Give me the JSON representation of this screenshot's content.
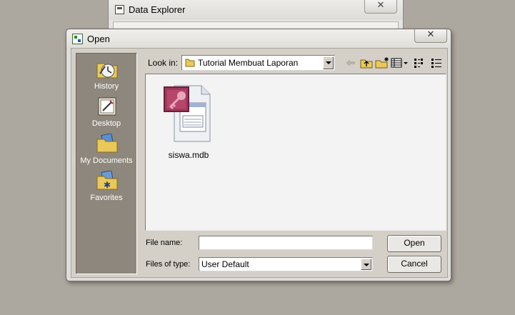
{
  "background_window": {
    "title": "Data Explorer",
    "close_label": "✕"
  },
  "dialog": {
    "title": "Open",
    "close_label": "✕"
  },
  "places": [
    {
      "label": "History"
    },
    {
      "label": "Desktop"
    },
    {
      "label": "My Documents"
    },
    {
      "label": "Favorites"
    }
  ],
  "lookin": {
    "label": "Look in:",
    "value": "Tutorial Membuat Laporan"
  },
  "toolbar": {
    "icons": [
      "back-icon",
      "up-folder-icon",
      "new-folder-icon",
      "views-menu-icon",
      "list-view-icon",
      "details-view-icon"
    ]
  },
  "files": [
    {
      "name": "siswa.mdb"
    }
  ],
  "filename": {
    "label": "File name:",
    "value": ""
  },
  "filetype": {
    "label": "Files of type:",
    "value": "User Default"
  },
  "buttons": {
    "open": "Open",
    "cancel": "Cancel"
  },
  "colors": {
    "places_bg": "#8e877d",
    "desktop_bg": "#aca89f",
    "dialog_bg": "#d4d0c8",
    "access_icon": "#a2395b"
  }
}
